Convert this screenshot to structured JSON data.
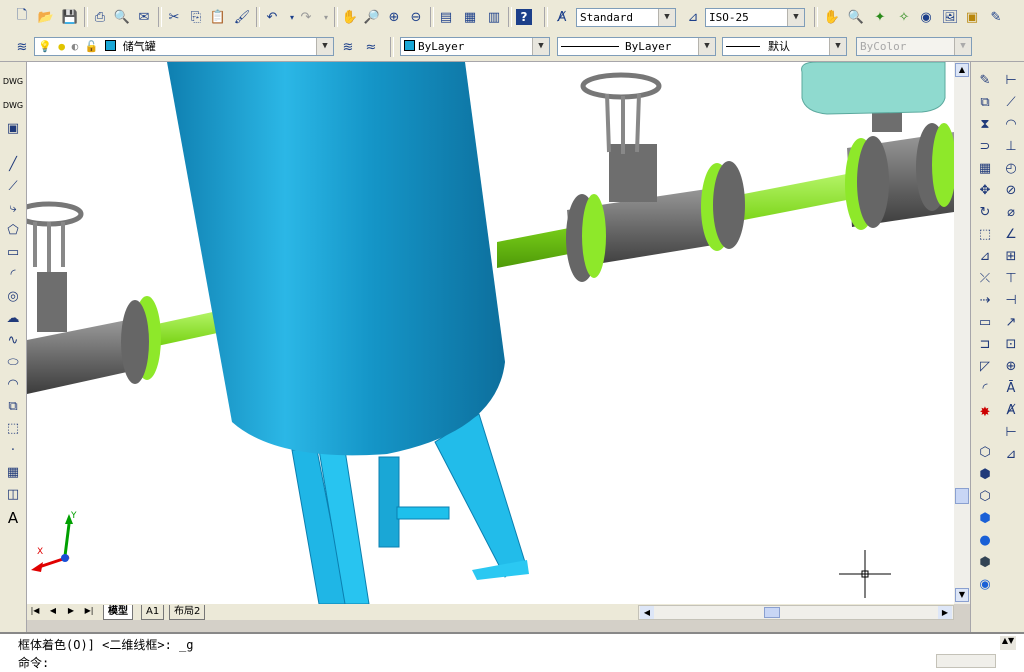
{
  "toolbar_standard": {
    "text_style": "Standard",
    "dim_style": "ISO-25"
  },
  "toolbar_layers": {
    "layer_name": "储气罐",
    "color": "ByLayer",
    "linetype": "ByLayer",
    "lineweight": "默认",
    "plotstyle": "ByColor"
  },
  "layout_tabs": [
    "模型",
    "A1",
    "布局2"
  ],
  "active_tab": "模型",
  "ucs": {
    "x_label": "X",
    "y_label": "Y"
  },
  "command": {
    "history": "框体着色(O)] <二维线框>: _g",
    "prompt": "命令:"
  },
  "colors": {
    "tank": "#1aa7d6",
    "pipe": "#88e622",
    "valve": "#6d6d6d",
    "bg": "#ffffff"
  }
}
